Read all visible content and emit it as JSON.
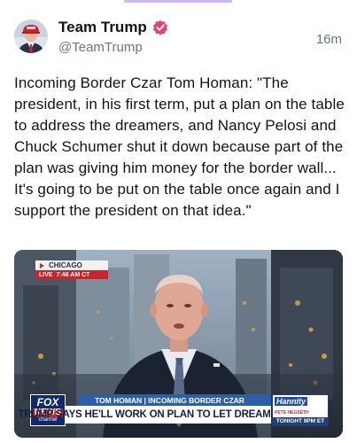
{
  "author": {
    "name": "Team Trump",
    "handle": "@TeamTrump",
    "time": "16m"
  },
  "post": {
    "text": "Incoming Border Czar Tom Homan: \"The president, in his first term, put a plan on the table to address the dreamers, and Nancy Pelosi and Chuck Schumer shut it down because part of the plan was giving him money for the border wall... It's going to be put on the table once again and I support the president on that idea.\""
  },
  "video": {
    "location_tag": "CHICAGO",
    "live_label": "LIVE",
    "live_time": "7:48 AM CT",
    "chyron_upper": "TOM HOMAN | INCOMING BORDER CZAR",
    "chyron_main": "TRUMP SAYS HE'LL WORK ON PLAN TO LET DREAMERS STAY",
    "network_top": "FOX",
    "network_mid": "NEWS",
    "network_bottom": "channel",
    "promo_show": "Hannity",
    "promo_host": "PETE HEGSETH",
    "promo_time": "TONIGHT 9PM ET"
  },
  "colors": {
    "verified_badge": "#e8406f",
    "text_primary": "#111418",
    "text_secondary": "#687684",
    "chyron_blue": "#2d5fa8",
    "live_red": "#c8242b"
  },
  "icons": {
    "verified": "verified-badge-icon",
    "avatar": "avatar-image"
  }
}
